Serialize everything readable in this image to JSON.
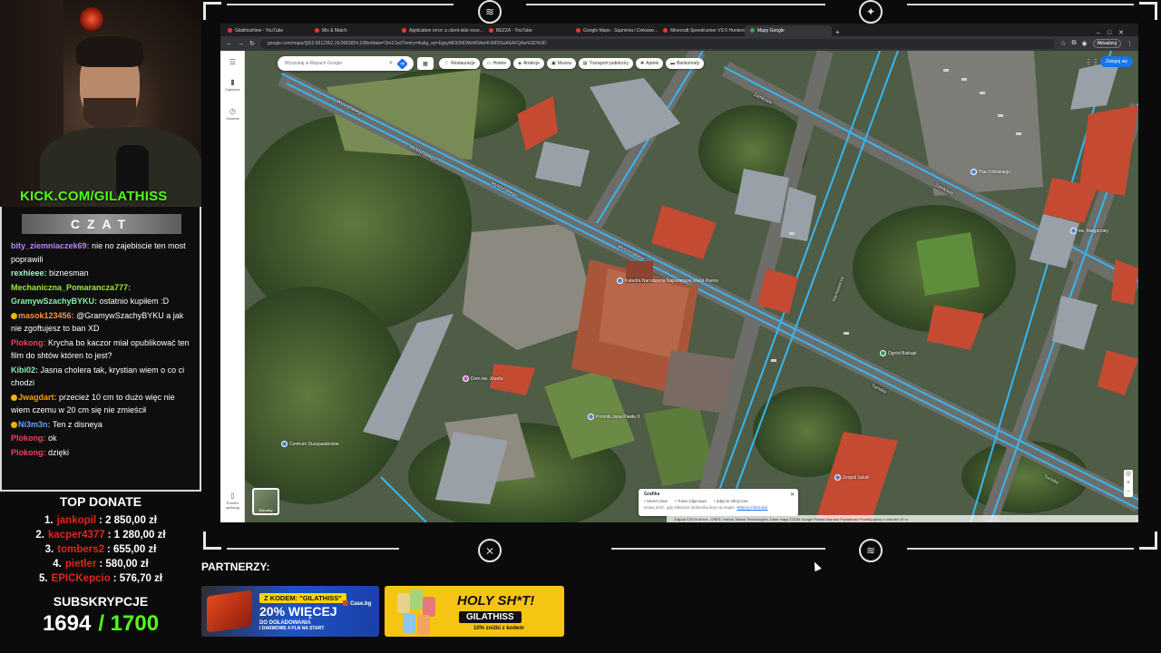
{
  "stream": {
    "kick_domain": "KICK.COM/",
    "kick_user": "GILATHISS",
    "chat_title": "CZAT"
  },
  "chat": {
    "messages": [
      {
        "user": "bity_ziemniaczek69:",
        "color": "#c084fc",
        "text": "nie no zajebiscie ten most poprawili",
        "badge": false
      },
      {
        "user": "rexhieee:",
        "color": "#a7f3d0",
        "text": "biznesman",
        "badge": false
      },
      {
        "user": "Mechaniczna_Pomarancza777:",
        "color": "#a3e635",
        "text": "",
        "badge": false
      },
      {
        "user": "GramywSzachyBYKU:",
        "color": "#86efac",
        "text": "ostatnio kupiłem :D",
        "badge": false
      },
      {
        "user": "masok123456:",
        "color": "#fb923c",
        "text": "@GramywSzachyBYKU a jak nie zgoftujesz to ban XD",
        "badge": true
      },
      {
        "user": "Plokong:",
        "color": "#f43f5e",
        "text": "Krycha bo kaczor miał opublikować ten film do shtów któren to jest?",
        "badge": false
      },
      {
        "user": "Kibi02:",
        "color": "#86efac",
        "text": "Jasna cholera tak, krystian wiem o co ci chodzi",
        "badge": false
      },
      {
        "user": "Jwagdart:",
        "color": "#f59e0b",
        "text": "przecież 10 cm to dużo więc nie wiem czemu w 20 cm się nie zmieścił",
        "badge": true
      },
      {
        "user": "Ni3m3n:",
        "color": "#60a5fa",
        "text": "Ten z disneya",
        "badge": true
      },
      {
        "user": "Plokong:",
        "color": "#f43f5e",
        "text": "ok",
        "badge": false
      },
      {
        "user": "Plokong:",
        "color": "#f43f5e",
        "text": "dzięki",
        "badge": false
      }
    ]
  },
  "donate": {
    "title": "TOP DONATE",
    "rows": [
      {
        "n": "1.",
        "u": "jankopil",
        "v": ": 2 850,00 zł"
      },
      {
        "n": "2.",
        "u": "kacper4377",
        "v": ": 1 280,00 zł"
      },
      {
        "n": "3.",
        "u": "tombers2",
        "v": ": 655,00 zł"
      },
      {
        "n": "4.",
        "u": "pietler",
        "v": ": 580,00 zł"
      },
      {
        "n": "5.",
        "u": "EPICKepcio",
        "v": ": 576,70 zł"
      }
    ]
  },
  "subs": {
    "title": "SUBSKRYPCJE",
    "current": "1694",
    "goal": "/ 1700"
  },
  "browser": {
    "tabs": [
      {
        "label": "GilathissNew - YouTube",
        "active": false
      },
      {
        "label": "Mix & Match",
        "active": false
      },
      {
        "label": "Application error: a client-side exce...",
        "active": false
      },
      {
        "label": "BEZZA - YouTube",
        "active": false
      },
      {
        "label": "Google Maps - Sqaminia i Ciekawe...",
        "active": false
      },
      {
        "label": "Minecraft Speedrunner VS 5 Hunters",
        "active": false
      },
      {
        "label": "Mapy Google",
        "active": true
      }
    ],
    "new_tab": "+",
    "url": "google.com/maps/@52.6612352,19.0681854,168m/data=!3m1!1e3?entry=ttu&g_ep=EgoyMDI2MDMxMS4wIKXMDSoASAFQAw%3D%3D",
    "update_label": "Aktualizuj"
  },
  "maps": {
    "search_placeholder": "Wyszukaj w Mapach Google",
    "chips": [
      "Restauracje",
      "Hotele",
      "Atrakcje",
      "Muzea",
      "Transport publiczny",
      "Apteki",
      "Bankomaty"
    ],
    "signin": "Zaloguj się",
    "rail": {
      "saved": "Zapisane",
      "recent": "Ostatnie",
      "get_app": "Pobierz aplikację"
    },
    "layers_label": "Warstwy",
    "street_card": {
      "title": "Grafika",
      "items": [
        "Street View",
        "Trasa zdjęciowa",
        "Zdjęcie sferyczne"
      ],
      "foot": "Nowa treść, gdy klikniesz niebieską linię na mapie.",
      "link": "Więcej informacji"
    },
    "footer": "Zdjęcia ©2026 Airbus, CNES / Airbus, Maxar Technologies, Dane mapy ©2026 Google   Polska   Warunki   Prywatność   Prześlij opinię o usłudze   10 m",
    "streets": [
      {
        "name": "Wyszyńskiego"
      },
      {
        "name": "Wyszyńskiego"
      },
      {
        "name": "Wyszyńskiego"
      },
      {
        "name": "Wyszyńskiego"
      },
      {
        "name": "Tumska"
      },
      {
        "name": "Tumska"
      },
      {
        "name": "Sienkiewicza"
      },
      {
        "name": "Zamkowa"
      },
      {
        "name": "Zamkowa"
      }
    ],
    "pois": [
      {
        "name": "Katedra Narodzenia Najświętszej Maryi Panny",
        "color": "blue"
      },
      {
        "name": "Dom św. Józefa",
        "color": "pink"
      },
      {
        "name": "Pomnik Jana Pawła II",
        "color": "blue"
      },
      {
        "name": "Centrum Duszpasterskie",
        "color": "blue"
      },
      {
        "name": "Zespół Szkół",
        "color": "blue"
      },
      {
        "name": "Ogród Biskupi",
        "color": "green"
      },
      {
        "name": "Plac Kilińskiego",
        "color": "blue"
      },
      {
        "name": "św. Małgorzaty",
        "color": "blue"
      }
    ]
  },
  "partners": {
    "label": "PARTNERZY:",
    "banner1": {
      "code": "Z KODEM: \"GILATHISS\"",
      "big": "20% WIĘCEJ",
      "sub": "DO DOŁADOWANIA",
      "sub2": "I DARMOWE 4 PLN NA START",
      "logo": "Case.bg"
    },
    "banner2": {
      "title": "HOLY SH*T!",
      "code": "GILATHISS",
      "sub": "10% zniżki z kodem"
    }
  }
}
